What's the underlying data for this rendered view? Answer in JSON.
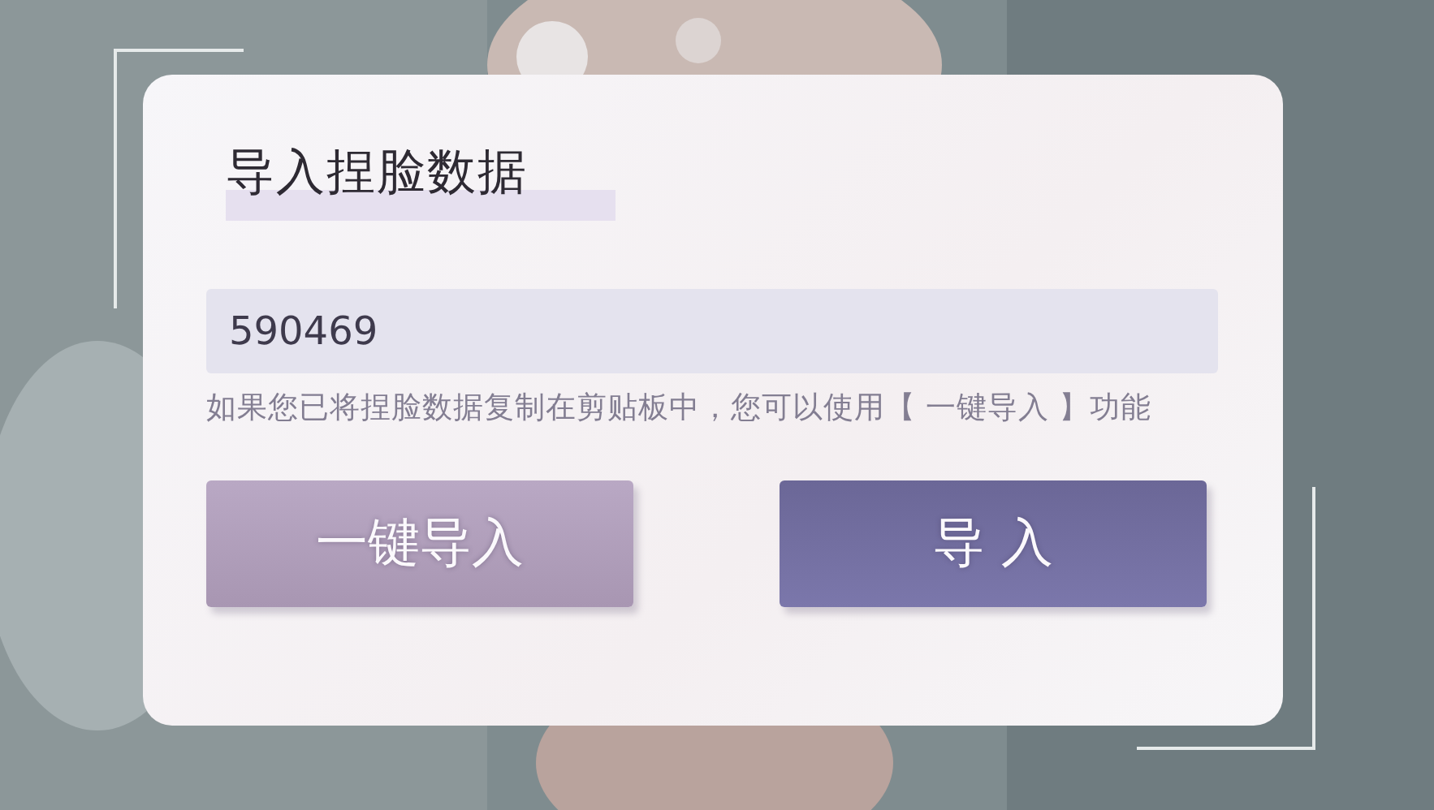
{
  "dialog": {
    "title": "导入捏脸数据",
    "field": {
      "value": "590469"
    },
    "hint": "如果您已将捏脸数据复制在剪贴板中，您可以使用【 一键导入 】功能",
    "buttons": [
      {
        "label": "一键导入",
        "kind": "secondary"
      },
      {
        "label": "导 入",
        "kind": "primary"
      }
    ]
  }
}
